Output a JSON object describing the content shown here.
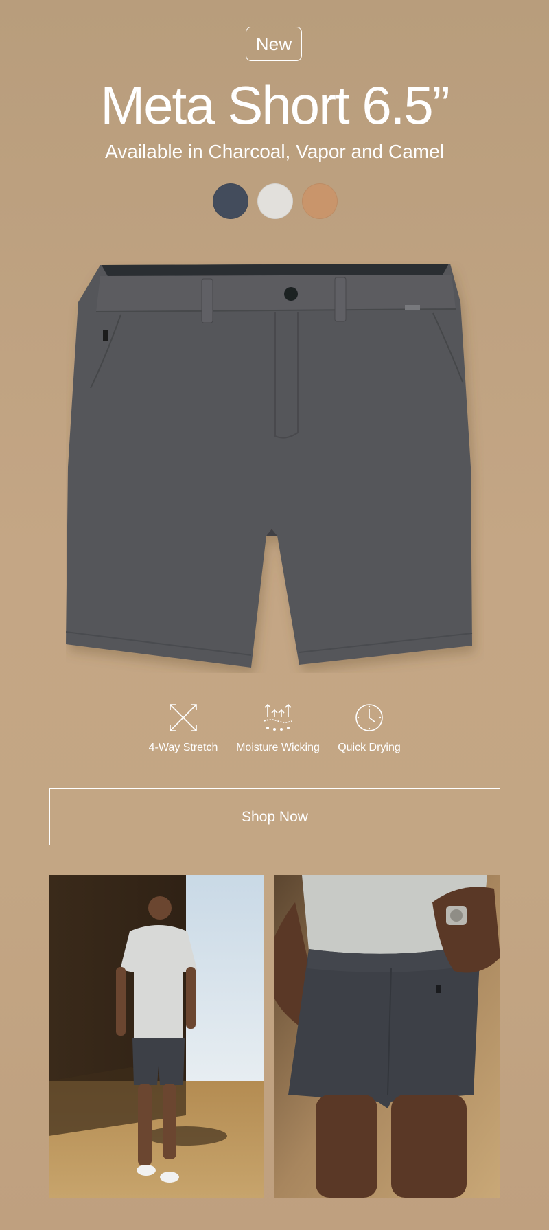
{
  "badge": "New",
  "title": "Meta Short 6.5”",
  "subtitle": "Available in Charcoal, Vapor and Camel",
  "swatches": [
    {
      "color_name": "Charcoal",
      "hex": "#434c5c"
    },
    {
      "color_name": "Vapor",
      "hex": "#e2e0dc"
    },
    {
      "color_name": "Camel",
      "hex": "#c9956b"
    }
  ],
  "features": [
    {
      "label": "4-Way Stretch",
      "icon": "stretch-arrows-icon"
    },
    {
      "label": "Moisture Wicking",
      "icon": "moisture-wicking-icon"
    },
    {
      "label": "Quick Drying",
      "icon": "clock-icon"
    }
  ],
  "cta": {
    "label": "Shop Now"
  },
  "colors": {
    "background": "#c2a483",
    "text": "#ffffff",
    "short_gray": "#555659",
    "short_navy": "#3d4047"
  }
}
